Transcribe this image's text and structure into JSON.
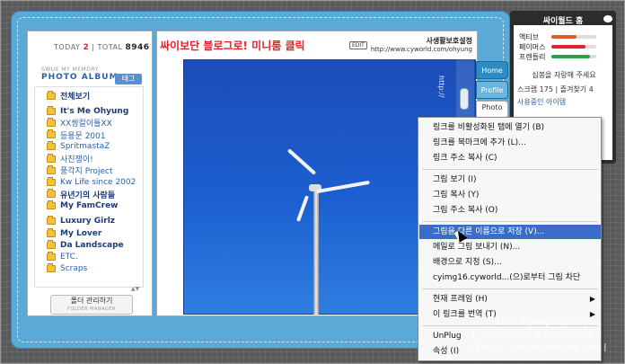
{
  "header": {
    "today_label": "TODAY",
    "today_count": "2",
    "total_label": "TOTAL",
    "total_count": "8946",
    "headline": "싸이보단 블로그로! 미니룸 클릭",
    "edit_label": "EDIT",
    "site_name": "사생활보호설정",
    "site_url": "http://www.cyworld.com/ohyung"
  },
  "album": {
    "small_title": "SWUE MY MEMORY",
    "title": "PHOTO ALBUM",
    "tag_button": "태그",
    "folders": [
      {
        "label": "전체보기",
        "bold": true
      },
      {
        "label": "It's Me Ohyung",
        "bold": true
      },
      {
        "label": "XX쌍칼이틀XX",
        "bold": false
      },
      {
        "label": "등용문 2001",
        "bold": false
      },
      {
        "label": "SpritmastaZ",
        "bold": false
      },
      {
        "label": "사진쟁이!",
        "bold": false
      },
      {
        "label": "풍각지 Project",
        "bold": false
      },
      {
        "label": "Kw Life since 2002",
        "bold": false
      },
      {
        "label": "유년기의 사람들",
        "bold": true
      },
      {
        "label": "My FamCrew",
        "bold": true
      },
      {
        "label": "Luxury Girlz",
        "bold": true
      },
      {
        "label": "My Lover",
        "bold": true
      },
      {
        "label": "Da Landscape",
        "bold": true
      },
      {
        "label": "ETC.",
        "bold": false
      },
      {
        "label": "Scraps",
        "bold": false
      }
    ],
    "manager_label": "폴더 관리하기",
    "manager_sub": "FOLDER MANAGER"
  },
  "photo": {
    "vertical_text": "http://"
  },
  "tabs": [
    "Home",
    "Profile",
    "Photo"
  ],
  "sidebar": {
    "title": "싸이월드 홈",
    "bars": [
      {
        "label": "액티브",
        "value": 0.55,
        "color": "#e05a2a"
      },
      {
        "label": "페이머스",
        "value": 0.75,
        "color": "#e0222a"
      },
      {
        "label": "프렌들리",
        "value": 0.85,
        "color": "#2aa04a"
      }
    ],
    "message": "심봉을 자랑해 주세요",
    "scrap_label": "스크랩",
    "scrap_count": "175",
    "follow_label": "즐겨찾기",
    "follow_count": "4",
    "link_text": "사용중인 아이템"
  },
  "context_menu": [
    {
      "label": "링크를 비활성화된 탭에 열기 (B)",
      "highlight": false,
      "submenu": false
    },
    {
      "label": "링크를 북마크에 추가 (L)...",
      "highlight": false,
      "submenu": false
    },
    {
      "label": "링크 주소 복사 (C)",
      "highlight": false,
      "submenu": false
    },
    {
      "sep": true
    },
    {
      "label": "그림 보기 (I)",
      "highlight": false,
      "submenu": false
    },
    {
      "label": "그림 복사 (Y)",
      "highlight": false,
      "submenu": false
    },
    {
      "label": "그림 주소 복사 (O)",
      "highlight": false,
      "submenu": false
    },
    {
      "sep": true
    },
    {
      "label": "그림을 다른 이름으로 저장 (V)...",
      "highlight": true,
      "submenu": false
    },
    {
      "label": "메일로 그림 보내기 (N)...",
      "highlight": false,
      "submenu": false
    },
    {
      "label": "배경으로 지정 (S)...",
      "highlight": false,
      "submenu": false
    },
    {
      "label": "cyimg16.cyworld...(으)로부터 그림 차단",
      "highlight": false,
      "submenu": false
    },
    {
      "sep": true
    },
    {
      "label": "현재 프레임 (H)",
      "highlight": false,
      "submenu": true
    },
    {
      "label": "이 링크를 번역 (T)",
      "highlight": false,
      "submenu": true
    },
    {
      "sep": true
    },
    {
      "label": "UnPlug",
      "highlight": false,
      "submenu": false
    },
    {
      "label": "속성 (I)",
      "highlight": false,
      "submenu": false
    }
  ],
  "credits": [
    "| It's Ohyung Style |",
    "| Ohyung.com & Ohyung.net |",
    "| Email - ohyung@ohyung.com |"
  ]
}
